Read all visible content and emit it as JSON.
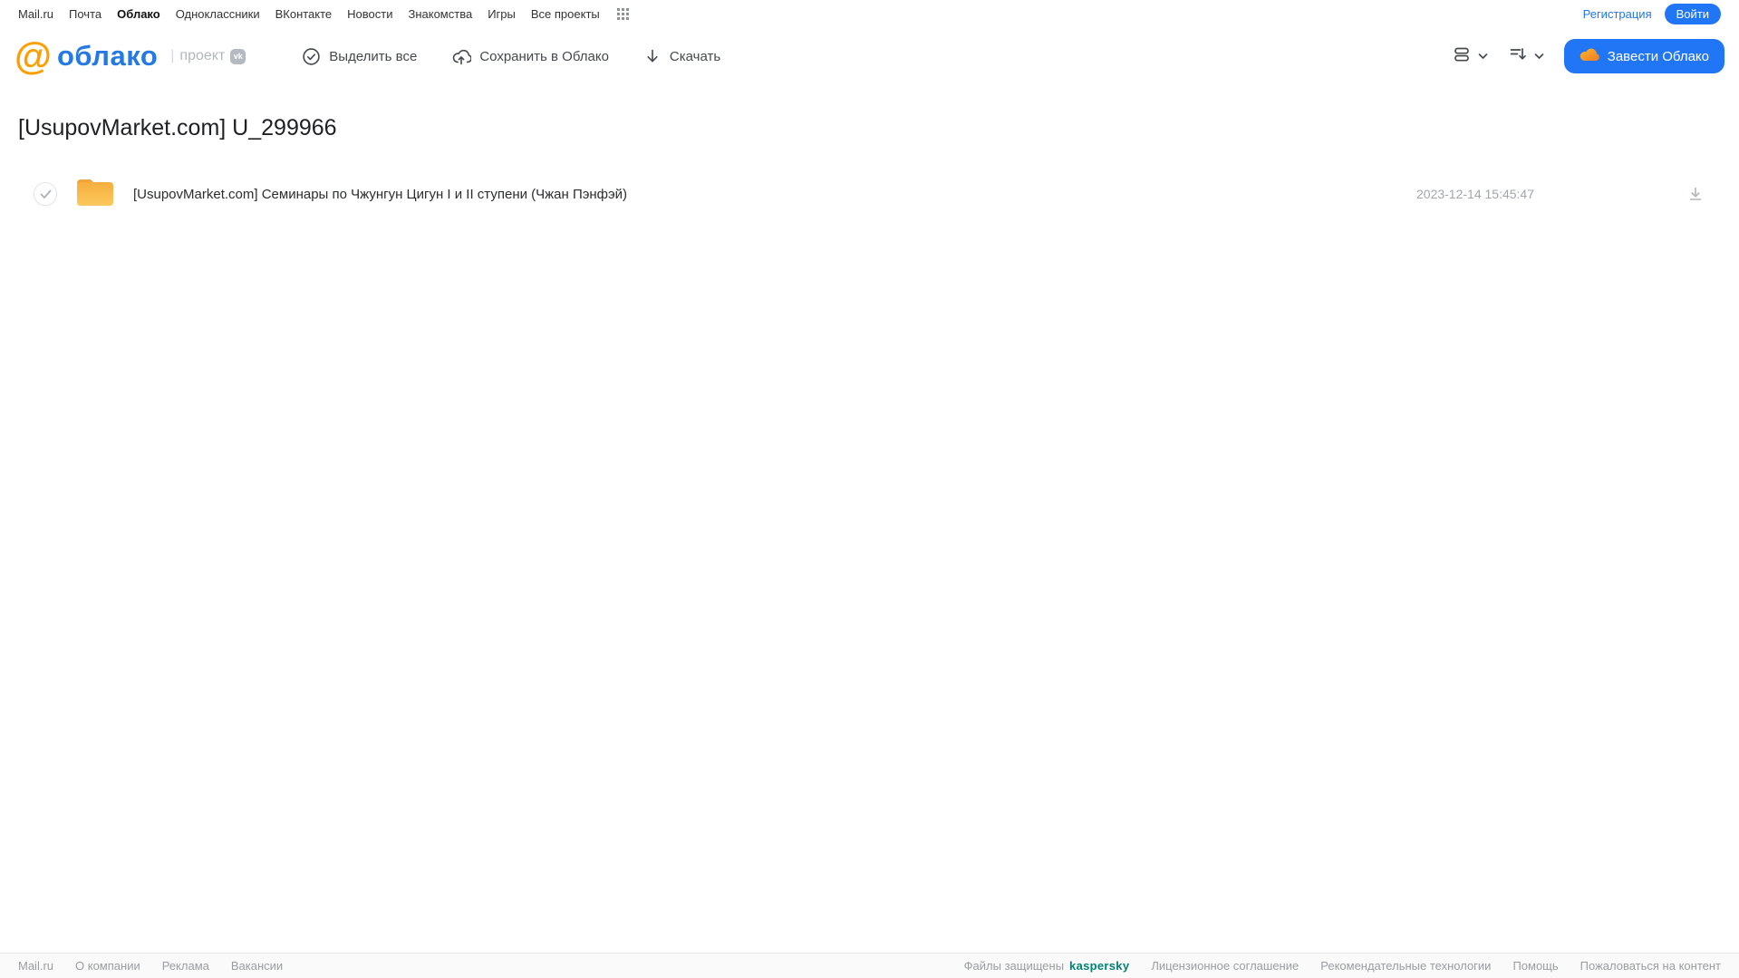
{
  "topnav": {
    "items": [
      "Mail.ru",
      "Почта",
      "Облако",
      "Одноклассники",
      "ВКонтакте",
      "Новости",
      "Знакомства",
      "Игры",
      "Все проекты"
    ],
    "register_label": "Регистрация",
    "login_label": "Войти"
  },
  "header": {
    "logo_at": "@",
    "logo_text": "облако",
    "project_separator": "|",
    "project_label": "проект",
    "vk_badge": "vk",
    "toolbar": {
      "select_all_label": "Выделить все",
      "save_to_cloud_label": "Сохранить в Облако",
      "download_label": "Скачать"
    },
    "create_cloud_label": "Завести Облако"
  },
  "main": {
    "title": "[UsupovMarket.com] U_299966",
    "files": [
      {
        "name": "[UsupovMarket.com] Семинары по Чжунгун Цигун I и II ступени (Чжан Пэнфэй)",
        "date": "2023-12-14 15:45:47"
      }
    ]
  },
  "footer": {
    "left_links": [
      "Mail.ru",
      "О компании",
      "Реклама",
      "Вакансии"
    ],
    "protected_label": "Файлы защищены",
    "kaspersky_label": "kaspersky",
    "right_links": [
      "Лицензионное соглашение",
      "Рекомендательные технологии",
      "Помощь",
      "Пожаловаться на контент"
    ]
  },
  "colors": {
    "accent_blue": "#2176f5",
    "logo_blue": "#2579e5",
    "logo_orange": "#ff9e00",
    "folder_yellow": "#f9be4e",
    "kaspersky_green": "#008272"
  }
}
